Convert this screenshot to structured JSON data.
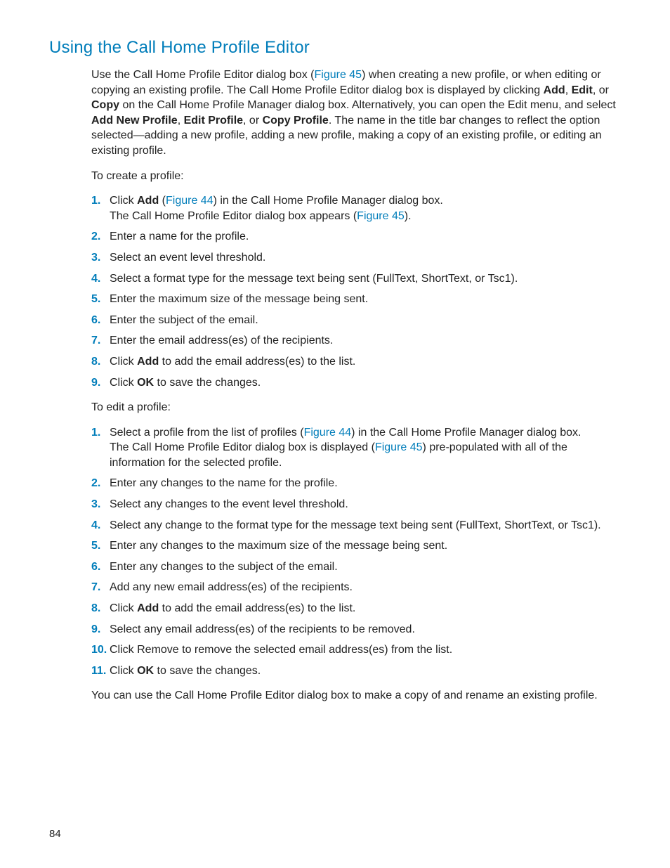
{
  "title": "Using the Call Home Profile Editor",
  "intro": {
    "parts": [
      {
        "t": "Use the Call Home Profile Editor dialog box ("
      },
      {
        "t": "Figure 45",
        "link": true
      },
      {
        "t": ") when creating a new profile, or when editing or copying an existing profile. The Call Home Profile Editor dialog box is displayed by clicking "
      },
      {
        "t": "Add",
        "bold": true
      },
      {
        "t": ", "
      },
      {
        "t": "Edit",
        "bold": true
      },
      {
        "t": ", or "
      },
      {
        "t": "Copy",
        "bold": true
      },
      {
        "t": " on the Call Home Profile Manager dialog box. Alternatively, you can open the Edit menu, and select "
      },
      {
        "t": "Add New Profile",
        "bold": true
      },
      {
        "t": ", "
      },
      {
        "t": "Edit Profile",
        "bold": true
      },
      {
        "t": ", or "
      },
      {
        "t": "Copy Profile",
        "bold": true
      },
      {
        "t": ". The name in the title bar changes to reflect the option selected—adding a new profile, adding a new profile, making a copy of an existing profile, or editing an existing profile."
      }
    ]
  },
  "create_lead": "To create a profile:",
  "create_steps": [
    {
      "num": "1.",
      "parts": [
        {
          "t": "Click "
        },
        {
          "t": "Add",
          "bold": true
        },
        {
          "t": " ("
        },
        {
          "t": "Figure 44",
          "link": true
        },
        {
          "t": ") in the Call Home Profile Manager dialog box."
        }
      ],
      "sub_parts": [
        {
          "t": "The Call Home Profile Editor dialog box appears ("
        },
        {
          "t": "Figure 45",
          "link": true
        },
        {
          "t": ")."
        }
      ]
    },
    {
      "num": "2.",
      "parts": [
        {
          "t": "Enter a name for the profile."
        }
      ]
    },
    {
      "num": "3.",
      "parts": [
        {
          "t": "Select an event level threshold."
        }
      ]
    },
    {
      "num": "4.",
      "parts": [
        {
          "t": "Select a format type for the message text being sent (FullText, ShortText, or Tsc1)."
        }
      ]
    },
    {
      "num": "5.",
      "parts": [
        {
          "t": "Enter the maximum size of the message being sent."
        }
      ]
    },
    {
      "num": "6.",
      "parts": [
        {
          "t": "Enter the subject of the email."
        }
      ]
    },
    {
      "num": "7.",
      "parts": [
        {
          "t": "Enter the email address(es) of the recipients."
        }
      ]
    },
    {
      "num": "8.",
      "parts": [
        {
          "t": "Click "
        },
        {
          "t": "Add",
          "bold": true
        },
        {
          "t": " to add the email address(es) to the list."
        }
      ]
    },
    {
      "num": "9.",
      "parts": [
        {
          "t": "Click "
        },
        {
          "t": "OK",
          "bold": true
        },
        {
          "t": " to save the changes."
        }
      ]
    }
  ],
  "edit_lead": "To edit a profile:",
  "edit_steps": [
    {
      "num": "1.",
      "parts": [
        {
          "t": "Select a profile from the list of profiles ("
        },
        {
          "t": "Figure 44",
          "link": true
        },
        {
          "t": ") in the Call Home Profile Manager dialog box."
        }
      ],
      "sub_parts": [
        {
          "t": "The Call Home Profile Editor dialog box is displayed ("
        },
        {
          "t": "Figure 45",
          "link": true
        },
        {
          "t": ") pre-populated with all of the information for the selected profile."
        }
      ]
    },
    {
      "num": "2.",
      "parts": [
        {
          "t": "Enter any changes to the name for the profile."
        }
      ]
    },
    {
      "num": "3.",
      "parts": [
        {
          "t": "Select any changes to the event level threshold."
        }
      ]
    },
    {
      "num": "4.",
      "parts": [
        {
          "t": "Select any change to the format type for the message text being sent (FullText, ShortText, or Tsc1)."
        }
      ]
    },
    {
      "num": "5.",
      "parts": [
        {
          "t": "Enter any changes to the maximum size of the message being sent."
        }
      ]
    },
    {
      "num": "6.",
      "parts": [
        {
          "t": "Enter any changes to the subject of the email."
        }
      ]
    },
    {
      "num": "7.",
      "parts": [
        {
          "t": "Add any new email address(es) of the recipients."
        }
      ]
    },
    {
      "num": "8.",
      "parts": [
        {
          "t": "Click "
        },
        {
          "t": "Add",
          "bold": true
        },
        {
          "t": " to add the email address(es) to the list."
        }
      ]
    },
    {
      "num": "9.",
      "parts": [
        {
          "t": "Select any email address(es) of the recipients to be removed."
        }
      ]
    },
    {
      "num": "10.",
      "parts": [
        {
          "t": "Click Remove to remove the selected email address(es) from the list."
        }
      ]
    },
    {
      "num": "11.",
      "parts": [
        {
          "t": "Click "
        },
        {
          "t": "OK",
          "bold": true
        },
        {
          "t": " to save the changes."
        }
      ]
    }
  ],
  "closing": "You can use the Call Home Profile Editor dialog box to make a copy of and rename an existing profile.",
  "page_number": "84"
}
